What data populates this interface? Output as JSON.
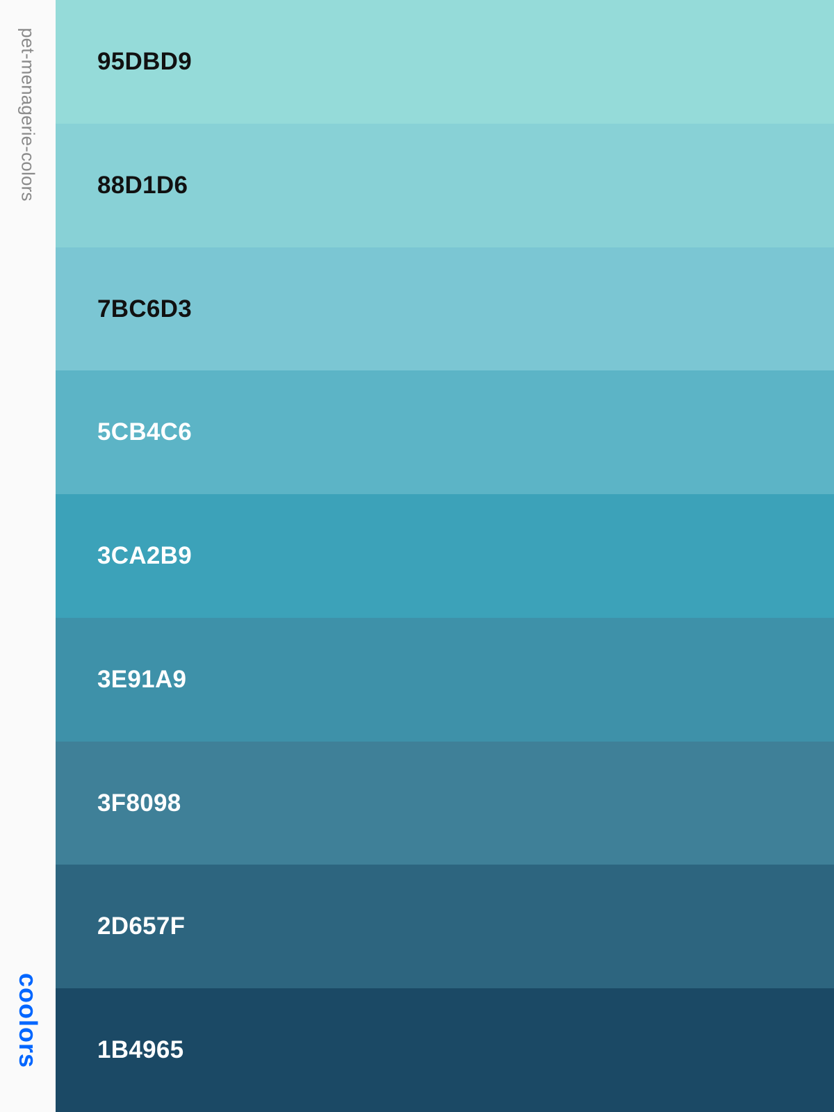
{
  "palette_name": "pet-menagerie-colors",
  "brand": "coolors",
  "brand_color": "#0066ff",
  "swatches": [
    {
      "hex": "95DBD9",
      "color": "#95DBD9",
      "text_color": "#111111"
    },
    {
      "hex": "88D1D6",
      "color": "#88D1D6",
      "text_color": "#111111"
    },
    {
      "hex": "7BC6D3",
      "color": "#7BC6D3",
      "text_color": "#111111"
    },
    {
      "hex": "5CB4C6",
      "color": "#5CB4C6",
      "text_color": "#ffffff"
    },
    {
      "hex": "3CA2B9",
      "color": "#3CA2B9",
      "text_color": "#ffffff"
    },
    {
      "hex": "3E91A9",
      "color": "#3E91A9",
      "text_color": "#ffffff"
    },
    {
      "hex": "3F8098",
      "color": "#3F8098",
      "text_color": "#ffffff"
    },
    {
      "hex": "2D657F",
      "color": "#2D657F",
      "text_color": "#ffffff"
    },
    {
      "hex": "1B4965",
      "color": "#1B4965",
      "text_color": "#ffffff"
    }
  ]
}
